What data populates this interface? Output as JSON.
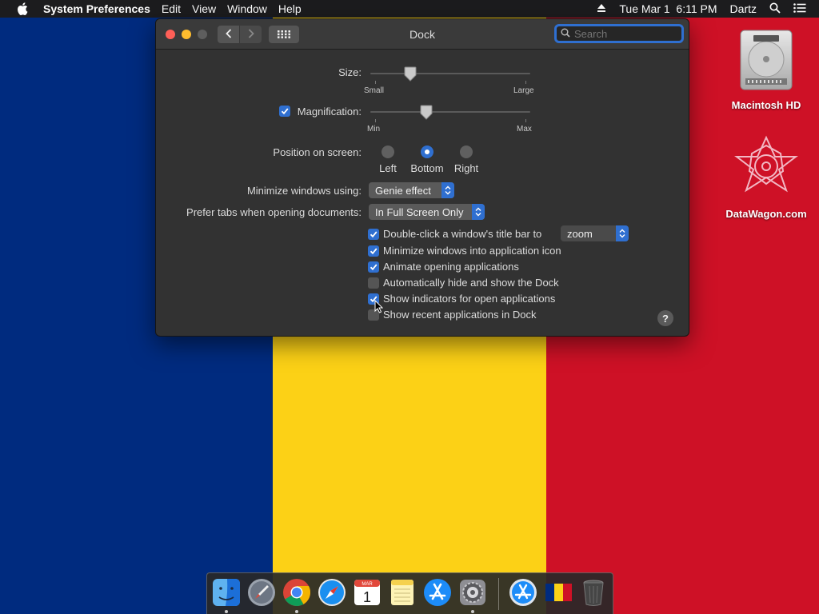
{
  "menubar": {
    "app_name": "System Preferences",
    "menus": [
      "Edit",
      "View",
      "Window",
      "Help"
    ],
    "clock": "Tue Mar 1  6:11 PM",
    "user": "Dartz",
    "icons": [
      "apple-icon",
      "eject-icon",
      "spotlight-search-icon",
      "notification-center-icon"
    ]
  },
  "wallpaper": {
    "colors": [
      "#002B7F",
      "#FCD116",
      "#CE1126"
    ]
  },
  "window": {
    "title": "Dock",
    "search_placeholder": "Search",
    "size": {
      "label": "Size:",
      "min_label": "Small",
      "max_label": "Large",
      "value": 0.25
    },
    "magnification": {
      "label": "Magnification:",
      "checked": true,
      "min_label": "Min",
      "max_label": "Max",
      "value": 0.35
    },
    "position": {
      "label": "Position on screen:",
      "options": [
        "Left",
        "Bottom",
        "Right"
      ],
      "selected": "Bottom"
    },
    "minimize_using": {
      "label": "Minimize windows using:",
      "value": "Genie effect"
    },
    "prefer_tabs": {
      "label": "Prefer tabs when opening documents:",
      "value": "In Full Screen Only"
    },
    "options": [
      {
        "label": "Double-click a window's title bar to",
        "checked": true
      },
      {
        "label": "Minimize windows into application icon",
        "checked": true
      },
      {
        "label": "Animate opening applications",
        "checked": true
      },
      {
        "label": "Automatically hide and show the Dock",
        "checked": false
      },
      {
        "label": "Show indicators for open applications",
        "checked": true
      },
      {
        "label": "Show recent applications in Dock",
        "checked": false
      }
    ],
    "double_click_action": "zoom",
    "help": "?"
  },
  "desktop": {
    "icons": [
      {
        "label": "Macintosh HD",
        "icon": "hard-drive-icon"
      },
      {
        "label": "DataWagon.com",
        "icon": "datawagon-logo-icon"
      }
    ]
  },
  "dock": {
    "apps": [
      {
        "name": "Finder",
        "icon": "finder-icon",
        "running": true
      },
      {
        "name": "Launchpad",
        "icon": "launchpad-icon",
        "running": false
      },
      {
        "name": "Google Chrome",
        "icon": "chrome-icon",
        "running": true
      },
      {
        "name": "Safari",
        "icon": "safari-icon",
        "running": false
      },
      {
        "name": "Calendar",
        "icon": "calendar-icon",
        "running": false,
        "month": "MAR",
        "day": "1"
      },
      {
        "name": "Notes",
        "icon": "notes-icon",
        "running": false
      },
      {
        "name": "App Store",
        "icon": "app-store-icon",
        "running": false
      },
      {
        "name": "System Preferences",
        "icon": "system-preferences-icon",
        "running": true
      },
      {
        "name": "Applications",
        "icon": "applications-folder-icon",
        "running": false
      },
      {
        "name": "Flag",
        "icon": "flag-file-icon",
        "running": false
      },
      {
        "name": "Trash",
        "icon": "trash-icon",
        "running": false
      }
    ]
  }
}
